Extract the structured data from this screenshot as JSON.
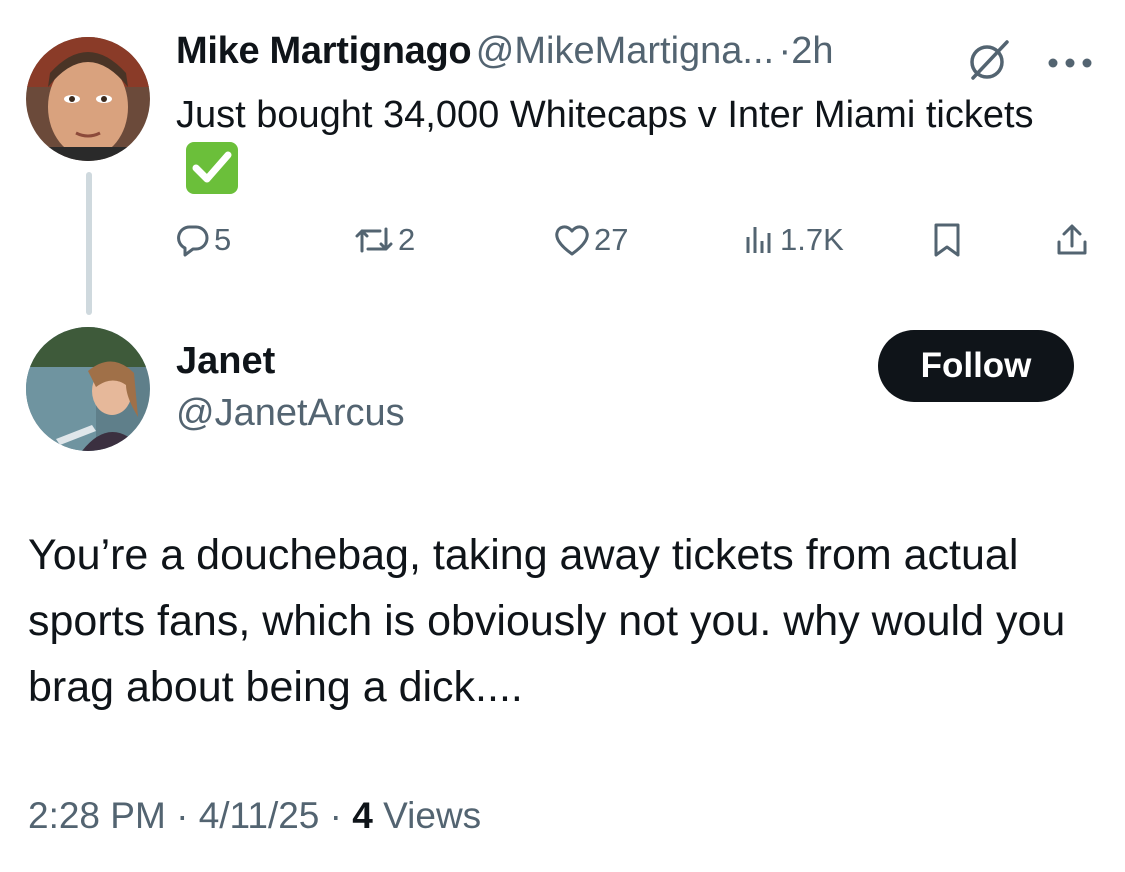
{
  "tweet": {
    "author_name": "Mike Martignago",
    "author_handle": "@MikeMartigna...",
    "separator": "·",
    "time": "2h",
    "text": "Just bought 34,000 Whitecaps v Inter Miami tickets",
    "emoji": "check-mark-button-emoji",
    "stats": {
      "replies": "5",
      "reposts": "2",
      "likes": "27",
      "views": "1.7K"
    }
  },
  "reply": {
    "author_name": "Janet",
    "author_handle": "@JanetArcus",
    "follow_label": "Follow",
    "text": "You’re a douchebag, taking away tickets from actual sports fans, which is obviously not you. why would you brag about being a dick....",
    "time": "2:28 PM",
    "sep1": " · ",
    "date": "4/11/25",
    "sep2": " · ",
    "views_count": "4",
    "views_label": " Views"
  },
  "icons": {
    "grok": "grok-icon",
    "more": "more-icon",
    "reply": "reply-icon",
    "repost": "repost-icon",
    "like": "heart-icon",
    "views": "bar-chart-icon",
    "bookmark": "bookmark-icon",
    "share": "share-icon"
  },
  "colors": {
    "text": "#0f1419",
    "secondary": "#536471",
    "thread_line": "#cfd9de",
    "follow_bg": "#0f1419",
    "emoji_green": "#6bbf3a"
  }
}
